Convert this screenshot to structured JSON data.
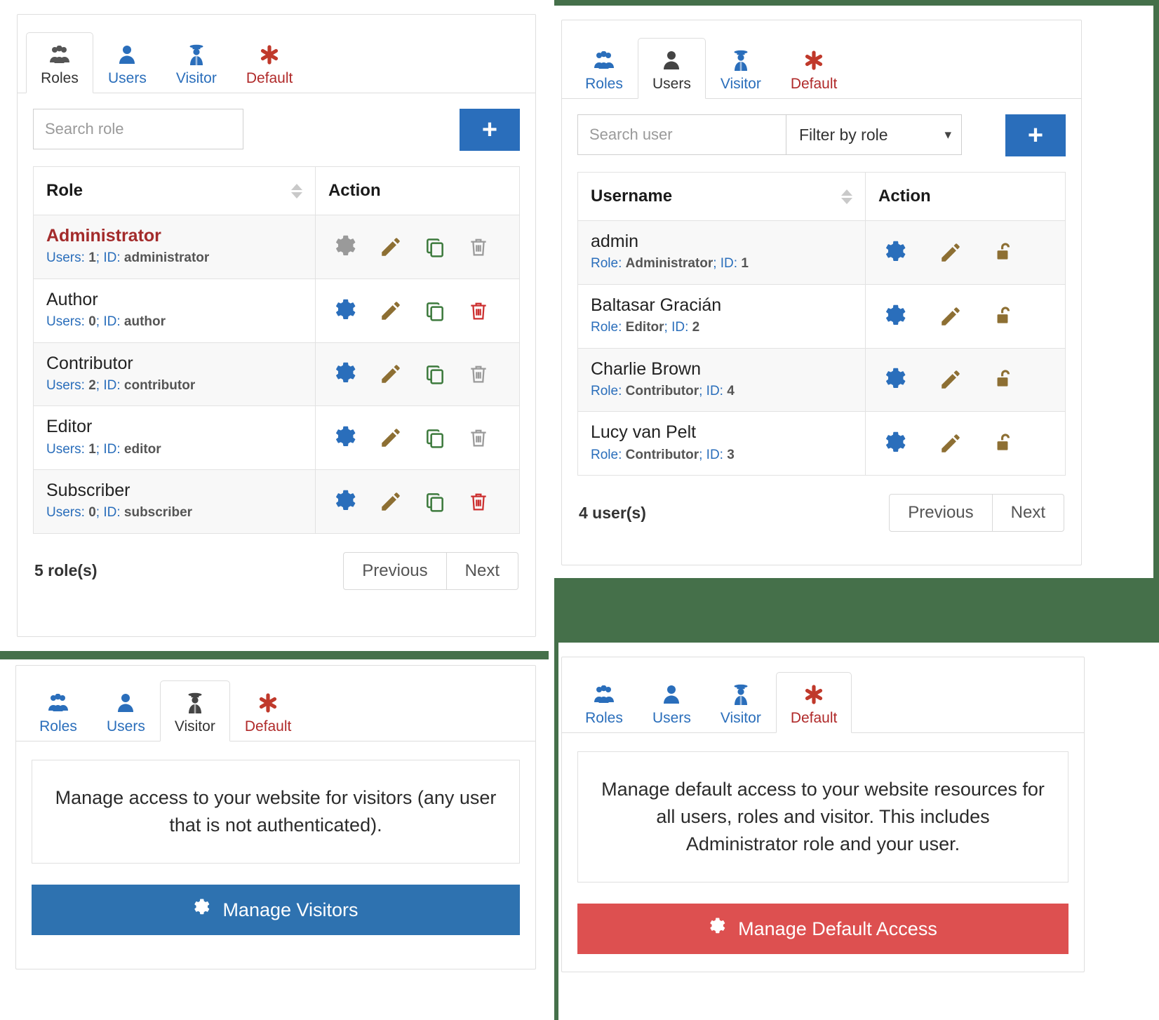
{
  "theme": {
    "backdrop_green": "#45704a",
    "accent_blue": "#2a6ebb",
    "danger_red": "#b02a2a",
    "button_red": "#dd5050",
    "pencil_gold": "#8d6f33",
    "copy_green": "#3d7a3d",
    "disabled_grey": "#9a9a9a"
  },
  "tabs": [
    {
      "key": "roles",
      "label": "Roles",
      "icon": "users-group-icon"
    },
    {
      "key": "users",
      "label": "Users",
      "icon": "user-icon"
    },
    {
      "key": "visitor",
      "label": "Visitor",
      "icon": "spy-icon"
    },
    {
      "key": "default",
      "label": "Default",
      "icon": "asterisk-icon"
    }
  ],
  "roles_panel": {
    "active_tab": "roles",
    "search": {
      "placeholder": "Search role",
      "value": ""
    },
    "add_button": {
      "label": "+",
      "name": "add-role-button"
    },
    "columns": [
      "Role",
      "Action"
    ],
    "rows": [
      {
        "name": "Administrator",
        "meta_prefix": "Users:",
        "users": "1",
        "meta_mid": "; ID:",
        "id": "administrator",
        "highlight": true,
        "actions": {
          "gear": "disabled",
          "pencil": "enabled",
          "copy": "enabled",
          "trash": "disabled"
        }
      },
      {
        "name": "Author",
        "meta_prefix": "Users:",
        "users": "0",
        "meta_mid": "; ID:",
        "id": "author",
        "highlight": false,
        "actions": {
          "gear": "enabled",
          "pencil": "enabled",
          "copy": "enabled",
          "trash": "enabled"
        }
      },
      {
        "name": "Contributor",
        "meta_prefix": "Users:",
        "users": "2",
        "meta_mid": "; ID:",
        "id": "contributor",
        "highlight": false,
        "actions": {
          "gear": "enabled",
          "pencil": "enabled",
          "copy": "enabled",
          "trash": "disabled"
        }
      },
      {
        "name": "Editor",
        "meta_prefix": "Users:",
        "users": "1",
        "meta_mid": "; ID:",
        "id": "editor",
        "highlight": false,
        "actions": {
          "gear": "enabled",
          "pencil": "enabled",
          "copy": "enabled",
          "trash": "disabled"
        }
      },
      {
        "name": "Subscriber",
        "meta_prefix": "Users:",
        "users": "0",
        "meta_mid": "; ID:",
        "id": "subscriber",
        "highlight": false,
        "actions": {
          "gear": "enabled",
          "pencil": "enabled",
          "copy": "enabled",
          "trash": "enabled"
        }
      }
    ],
    "count_label": "5 role(s)",
    "pager": {
      "previous": "Previous",
      "next": "Next"
    }
  },
  "users_panel": {
    "active_tab": "users",
    "search": {
      "placeholder": "Search user",
      "value": ""
    },
    "role_filter": {
      "label": "Filter by role",
      "chevron": "chevron-down-icon"
    },
    "add_button": {
      "label": "+",
      "name": "add-user-button"
    },
    "columns": [
      "Username",
      "Action"
    ],
    "rows": [
      {
        "name": "admin",
        "meta_prefix": "Role:",
        "role": "Administrator",
        "meta_mid": "; ID:",
        "id": "1",
        "actions": {
          "gear": "enabled",
          "pencil": "enabled",
          "lock": "unlocked"
        }
      },
      {
        "name": "Baltasar Gracián",
        "meta_prefix": "Role:",
        "role": "Editor",
        "meta_mid": "; ID:",
        "id": "2",
        "actions": {
          "gear": "enabled",
          "pencil": "enabled",
          "lock": "unlocked"
        }
      },
      {
        "name": "Charlie Brown",
        "meta_prefix": "Role:",
        "role": "Contributor",
        "meta_mid": "; ID:",
        "id": "4",
        "actions": {
          "gear": "enabled",
          "pencil": "enabled",
          "lock": "unlocked"
        }
      },
      {
        "name": "Lucy van Pelt",
        "meta_prefix": "Role:",
        "role": "Contributor",
        "meta_mid": "; ID:",
        "id": "3",
        "actions": {
          "gear": "enabled",
          "pencil": "enabled",
          "lock": "unlocked"
        }
      }
    ],
    "count_label": "4 user(s)",
    "pager": {
      "previous": "Previous",
      "next": "Next"
    }
  },
  "visitor_panel": {
    "active_tab": "visitor",
    "description": "Manage access to your website for visitors (any user that is not authenticated).",
    "action_button": {
      "label": "Manage Visitors",
      "icon": "gear-icon",
      "color": "#2e72b0"
    }
  },
  "default_panel": {
    "active_tab": "default",
    "description": "Manage default access to your website resources for all users, roles and visitor. This includes Administrator role and your user.",
    "action_button": {
      "label": "Manage Default Access",
      "icon": "gear-icon",
      "color": "#dd5050"
    }
  }
}
